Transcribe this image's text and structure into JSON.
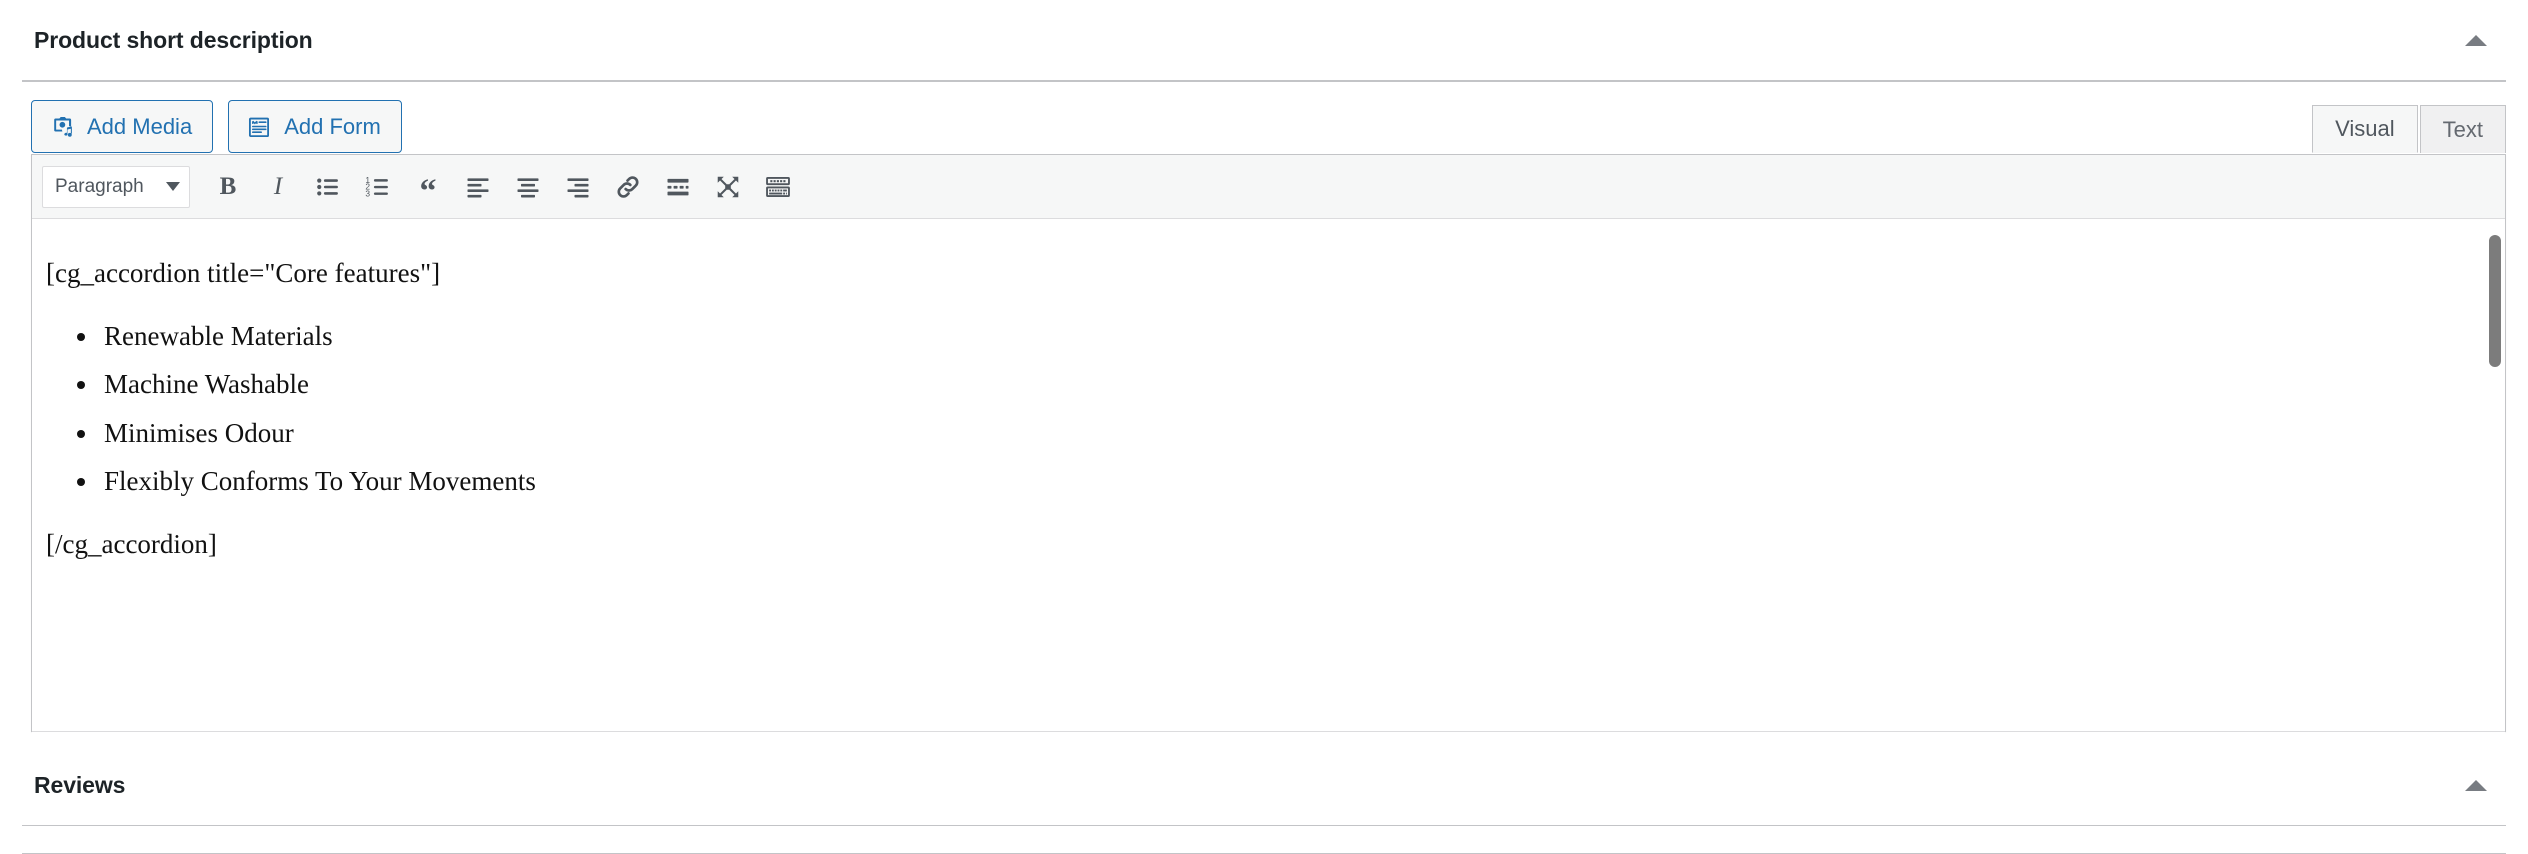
{
  "panels": [
    {
      "title": "Product short description",
      "toggle_icon": "caret-up-icon"
    },
    {
      "title": "Reviews",
      "toggle_icon": "caret-up-icon"
    }
  ],
  "media_buttons": [
    {
      "label": "Add Media",
      "icon": "media-camera-music-icon"
    },
    {
      "label": "Add Form",
      "icon": "form-clipboard-icon"
    }
  ],
  "editor_tabs": [
    {
      "label": "Visual",
      "active": true
    },
    {
      "label": "Text",
      "active": false
    }
  ],
  "toolbar": {
    "format_select": {
      "value": "Paragraph",
      "caret_icon": "chevron-down-icon"
    },
    "buttons": [
      {
        "name": "bold",
        "label": "B",
        "icon": "bold-icon"
      },
      {
        "name": "italic",
        "label": "I",
        "icon": "italic-icon"
      },
      {
        "name": "bullist",
        "label": "",
        "icon": "bulleted-list-icon"
      },
      {
        "name": "numlist",
        "label": "",
        "icon": "numbered-list-icon"
      },
      {
        "name": "blockquote",
        "label": "“",
        "icon": "blockquote-icon"
      },
      {
        "name": "alignleft",
        "label": "",
        "icon": "align-left-icon"
      },
      {
        "name": "aligncenter",
        "label": "",
        "icon": "align-center-icon"
      },
      {
        "name": "alignright",
        "label": "",
        "icon": "align-right-icon"
      },
      {
        "name": "link",
        "label": "",
        "icon": "link-icon"
      },
      {
        "name": "readmore",
        "label": "",
        "icon": "insert-read-more-icon"
      },
      {
        "name": "fullscreen",
        "label": "",
        "icon": "distraction-free-icon"
      },
      {
        "name": "toolbartoggle",
        "label": "",
        "icon": "keyboard-toolbar-toggle-icon"
      }
    ]
  },
  "editor_content": {
    "shortcode_open": "[cg_accordion title=\"Core features\"]",
    "list_items": [
      "Renewable Materials",
      "Machine Washable",
      "Minimises Odour",
      "Flexibly Conforms To Your Movements"
    ],
    "shortcode_close": "[/cg_accordion]"
  },
  "colors": {
    "accent": "#2271b1",
    "panel_border": "#c3c4c7",
    "toolbar_bg": "#f6f7f7",
    "text_dark": "#1d2327",
    "text_muted": "#50575e"
  }
}
